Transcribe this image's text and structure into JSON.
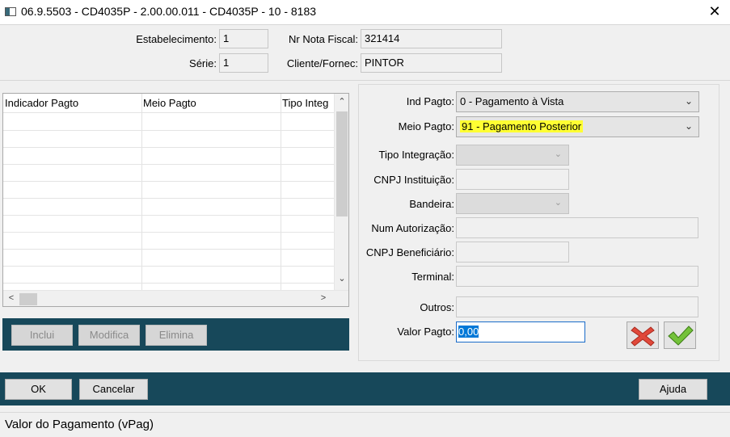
{
  "window": {
    "title": "06.9.5503 - CD4035P - 2.00.00.011 - CD4035P - 10 - 8183",
    "close_glyph": "✕"
  },
  "header": {
    "estabelecimento_label": "Estabelecimento:",
    "estabelecimento_value": "1",
    "serie_label": "Série:",
    "serie_value": "1",
    "nota_label": "Nr Nota Fiscal:",
    "nota_value": "321414",
    "cliente_label": "Cliente/Fornec:",
    "cliente_value": "PINTOR"
  },
  "grid": {
    "columns": [
      "Indicador Pagto",
      "Meio Pagto",
      "Tipo Integ"
    ],
    "arrows": {
      "up": "⌃",
      "down": "⌄",
      "left": "<",
      "right": ">"
    }
  },
  "grid_toolbar": {
    "inclui": "Inclui",
    "modifica": "Modifica",
    "elimina": "Elimina"
  },
  "form": {
    "ind_pagto_label": "Ind Pagto:",
    "ind_pagto_value": "0 - Pagamento à Vista",
    "meio_pagto_label": "Meio Pagto:",
    "meio_pagto_value": "91 - Pagamento Posterior",
    "tipo_integracao_label": "Tipo Integração:",
    "cnpj_instituicao_label": "CNPJ Instituição:",
    "bandeira_label": "Bandeira:",
    "num_autorizacao_label": "Num Autorização:",
    "cnpj_beneficiario_label": "CNPJ Beneficiário:",
    "terminal_label": "Terminal:",
    "outros_label": "Outros:",
    "valor_pagto_label": "Valor Pagto:",
    "valor_pagto_value_pre": "0",
    "valor_pagto_value_sel": ",00",
    "highlight_color": "#ffff33"
  },
  "footer": {
    "ok": "OK",
    "cancelar": "Cancelar",
    "ajuda": "Ajuda",
    "bar_color": "#17485a"
  },
  "status": {
    "text": "Valor do Pagamento (vPag)"
  }
}
